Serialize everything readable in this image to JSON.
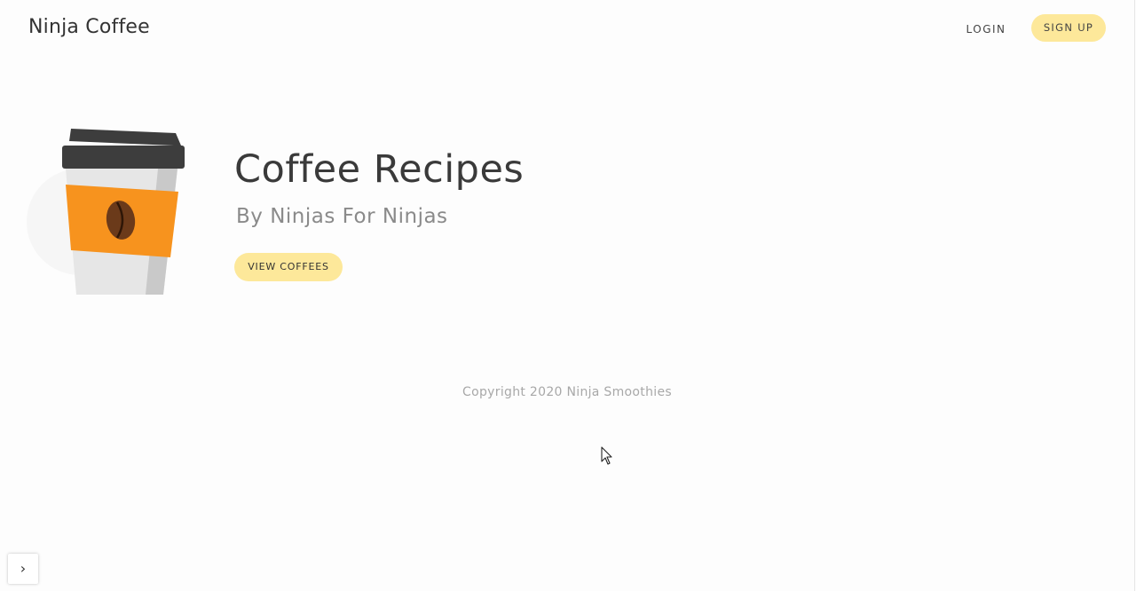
{
  "navbar": {
    "brand": "Ninja Coffee",
    "login_label": "LOGIN",
    "signup_label": "SIGN UP"
  },
  "hero": {
    "title": "Coffee Recipes",
    "subtitle": "By Ninjas For Ninjas",
    "button_label": "VIEW COFFEES",
    "image_icon": "coffee-cup-icon"
  },
  "footer": {
    "copyright": "Copyright 2020 Ninja Smoothies"
  },
  "sidebar_toggle": {
    "glyph": "›",
    "icon": "chevron-right-icon"
  },
  "colors": {
    "accent": "#fde89a",
    "background": "#fdfdfd",
    "cup_sleeve": "#f7931e",
    "cup_lid": "#3d3d3d"
  }
}
